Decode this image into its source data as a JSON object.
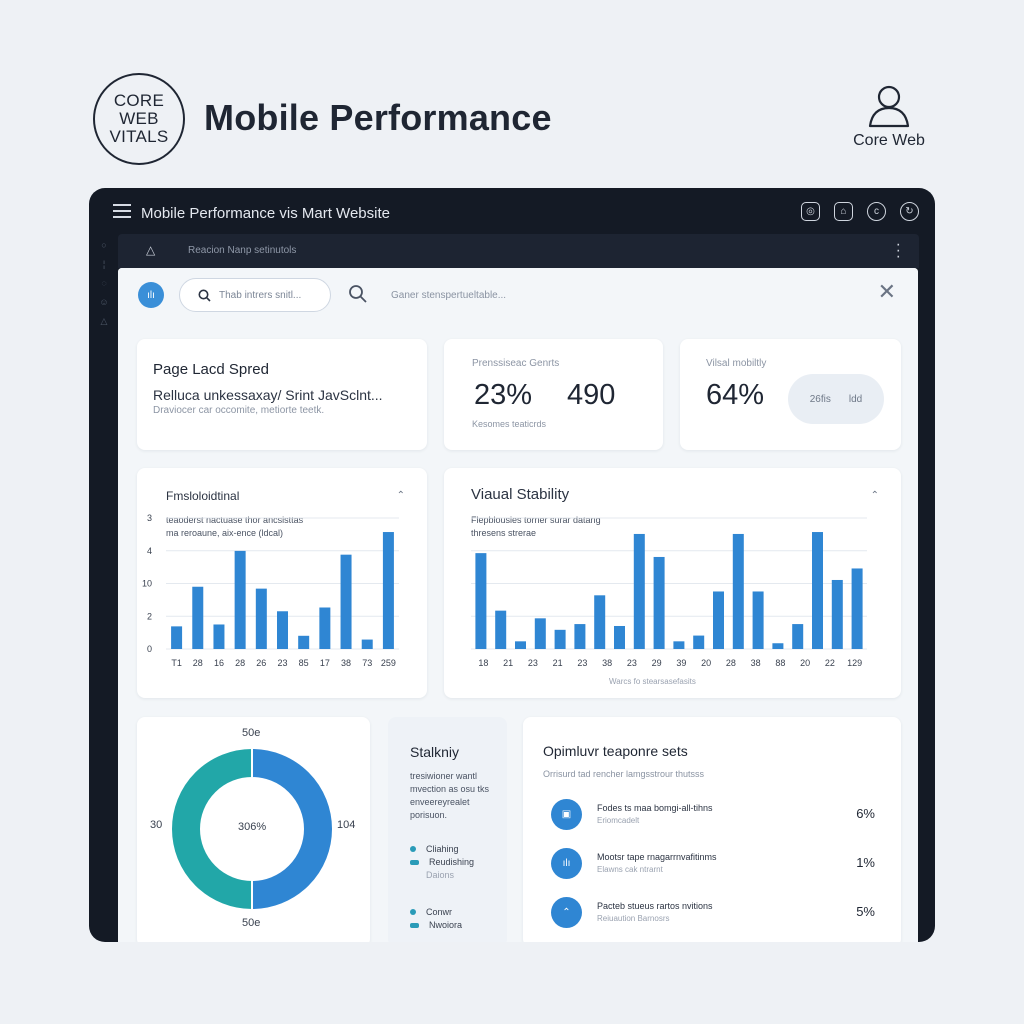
{
  "header": {
    "logo_lines": [
      "CORE",
      "WEB",
      "VITALS"
    ],
    "title": "Mobile Performance",
    "profile_label": "Core Web"
  },
  "window": {
    "title": "Mobile Performance vis Mart Website",
    "toolbar_crumb": "Reacion  Nanp setinutols"
  },
  "search": {
    "placeholder": "Thab intrers snitl...",
    "hint": "Ganer stenspertueltable..."
  },
  "metrics": {
    "page_load": {
      "title": "Page Lacd Spred",
      "subtitle": "Relluca unkessaxay/ Srint JavSclnt...",
      "detail": "Draviocer car occomite, metiorte teetk."
    },
    "summary": {
      "label": "Prenssiseac Genrts",
      "value_1": "23%",
      "value_2": "490",
      "footer": "Kesomes teaticrds"
    },
    "visual": {
      "label": "Vilsal mobiltly",
      "value": "64%",
      "pill_1": "26fis",
      "pill_2": "ldd"
    }
  },
  "chart_left": {
    "title": "Fmsloloidtinal",
    "desc_1": "teaoderst nactuase thor ancsisttas",
    "desc_2": "ma reroaune, aix-ence (ldcal)"
  },
  "chart_right": {
    "title": "Viaual Stability",
    "desc_1": "Flepblousies torner surar datang",
    "desc_2": "thresens strerae",
    "footer": "Warcs fo stearsasefasits"
  },
  "chart_data": [
    {
      "type": "bar",
      "title": "Fmsloloidtinal",
      "y_tick_labels": [
        "0",
        "2",
        "10",
        "4",
        "3"
      ],
      "ylim": [
        0,
        10
      ],
      "x_tick_labels": [
        "T1",
        "28",
        "16",
        "28",
        "26",
        "23",
        "85",
        "17",
        "38",
        "73",
        "259"
      ],
      "values": [
        1.2,
        3.3,
        1.3,
        5.2,
        3.2,
        2.0,
        0.7,
        2.2,
        5.0,
        0.5,
        6.2
      ],
      "bar_color": "#2f86d3",
      "grid": true
    },
    {
      "type": "bar",
      "title": "Viaual Stability",
      "x_tick_labels": [
        "18",
        "21",
        "23",
        "21",
        "23",
        "38",
        "23",
        "29",
        "39",
        "20",
        "28",
        "38",
        "88",
        "20",
        "22",
        "129"
      ],
      "values": [
        5.0,
        2.0,
        0.4,
        1.6,
        1.0,
        1.3,
        2.8,
        1.2,
        6.0,
        4.8,
        0.4,
        0.7,
        3.0,
        6.0,
        3.0,
        0.3,
        1.3,
        6.1,
        3.6,
        4.2
      ],
      "bar_color": "#2f86d3",
      "grid": true
    },
    {
      "type": "pie",
      "center_label": "306%",
      "labels": {
        "top": "50e",
        "left": "30",
        "right": "104",
        "bottom": "50e"
      },
      "slices": [
        {
          "value": 50,
          "color": "#2f86d3"
        },
        {
          "value": 50,
          "color": "#22a7a8"
        }
      ]
    }
  ],
  "stability": {
    "title": "Stalkniy",
    "desc": [
      "tresiwioner wantl",
      "mvection as osu tks",
      "enveereyrealet",
      "porisuon."
    ],
    "legend_1": [
      "Cliahing",
      "Reudishing",
      "Daions"
    ],
    "legend_2": [
      "Conwr",
      "Nwoiora"
    ]
  },
  "opportunities": {
    "title": "Opimluvr teaponre sets",
    "subtitle": "Orrisurd tad rencher lamgsstrour thutsss",
    "rows": [
      {
        "title": "Fodes ts maa bomgi-all-tihns",
        "sub": "Eriomcadelt",
        "pct": "6%"
      },
      {
        "title": "Mootsr tape rnagarrnvafitinms",
        "sub": "Elawns cak ntrarnt",
        "pct": "1%"
      },
      {
        "title": "Pacteb stueus rartos nvitions",
        "sub": "Reiuaution Barnosrs",
        "pct": "5%"
      }
    ]
  }
}
